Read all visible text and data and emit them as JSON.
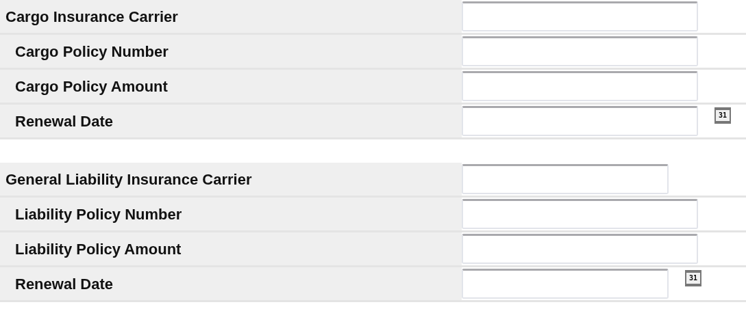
{
  "sections": [
    {
      "rows": [
        {
          "kind": "heading",
          "label": "Cargo Insurance Carrier",
          "input": {
            "kind": "wide"
          },
          "calendar_button": null
        },
        {
          "kind": "field",
          "label": "Cargo Policy Number",
          "input": {
            "kind": "wide"
          },
          "calendar_button": null
        },
        {
          "kind": "field",
          "label": "Cargo Policy Amount",
          "input": {
            "kind": "wide"
          },
          "calendar_button": null
        },
        {
          "kind": "field",
          "label": "Renewal Date",
          "input": {
            "kind": "wide"
          },
          "calendar_button": {
            "label": "31"
          }
        }
      ]
    },
    {
      "rows": [
        {
          "kind": "heading",
          "label": "General Liability Insurance Carrier",
          "input": {
            "kind": "narrow"
          },
          "calendar_button": null
        },
        {
          "kind": "field",
          "label": "Liability Policy Number",
          "input": {
            "kind": "wide"
          },
          "calendar_button": null
        },
        {
          "kind": "field",
          "label": "Liability Policy Amount",
          "input": {
            "kind": "wide"
          },
          "calendar_button": null
        },
        {
          "kind": "field",
          "label": "Renewal Date",
          "input": {
            "kind": "narrow"
          },
          "calendar_button": {
            "label": "31"
          }
        }
      ]
    }
  ]
}
